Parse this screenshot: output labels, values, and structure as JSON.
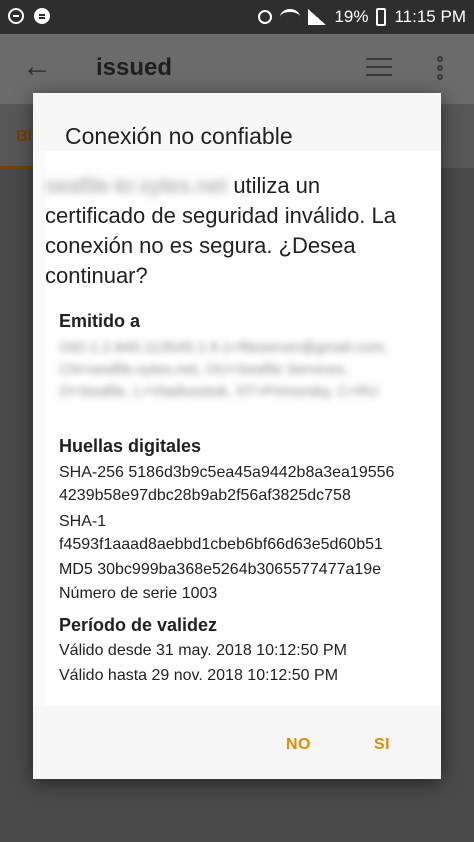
{
  "status_bar": {
    "battery_text": "19%",
    "time": "11:15 PM",
    "icons": [
      "minus-circle-icon",
      "spotify-icon",
      "alarm-icon",
      "wifi-icon",
      "signal-icon",
      "battery-icon"
    ]
  },
  "app_bar": {
    "title": "issued",
    "back_icon": "back-arrow-icon",
    "sort_icon": "sort-icon",
    "more_icon": "more-vert-icon",
    "tab_fragment": "Bl"
  },
  "dialog": {
    "title": "Conexión no confiable",
    "host_blurred": "seafile-kr.sytes.net",
    "intro_text": "utiliza un certificado de seguridad inválido. La conexión no es segura. ¿Desea continuar?",
    "issued_to_heading": "Emitido a",
    "issuer_blurred": "OID.1.2.840.113549.1.9.1=fileserver@gmail.com, CN=seafile.sytes.net, OU=Seafile Services, O=Seafile, L=Vladivostok, ST=Primorsky, C=RU",
    "fingerprints_heading": "Huellas digitales",
    "sha256_line1": "SHA-256 5186d3b9c5ea45a9442b8a3ea19556",
    "sha256_line2": "4239b58e97dbc28b9ab2f56af3825dc758",
    "sha1_label": "SHA-1",
    "sha1_value": "f4593f1aaad8aebbd1cbeb6bf66d63e5d60b51",
    "md5_line": "MD5 30bc999ba368e5264b3065577477a19e",
    "serial_line": "Número de serie 1003",
    "validity_heading": "Período de validez",
    "valid_from": "Válido desde 31 may. 2018 10:12:50 PM",
    "valid_until": "Válido hasta 29 nov. 2018 10:12:50 PM",
    "no_label": "NO",
    "yes_label": "SI"
  },
  "colors": {
    "accent": "#e68a00",
    "dim_background": "#4a4a4a"
  }
}
